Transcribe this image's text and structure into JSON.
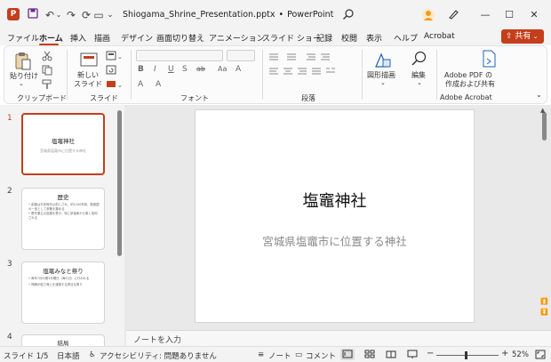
{
  "window": {
    "title": "Shiogama_Shrine_Presentation.pptx",
    "title_sep": "•",
    "app_name": "PowerPoint",
    "app_icon_letter": "P",
    "undo_label": "↶",
    "redo_label": "↷",
    "refresh_label": "⟳",
    "slideshow_label": "▭",
    "customize_label": "⌄",
    "minimize_label": "—",
    "maximize_label": "☐",
    "close_label": "✕"
  },
  "menu": {
    "tabs": [
      "ファイル",
      "ホーム",
      "挿入",
      "描画",
      "デザイン",
      "画面切り替え",
      "アニメーション",
      "スライド ショー",
      "記録",
      "校閲",
      "表示",
      "ヘルプ",
      "Acrobat"
    ],
    "active_tab": "ホーム",
    "share_label": "共有"
  },
  "ribbon": {
    "groups": [
      "クリップボード",
      "スライド",
      "フォント",
      "段落",
      "Adobe Acrobat"
    ],
    "paste_label": "貼り付け",
    "new_slide_label_line1": "新しい",
    "new_slide_label_line2": "スライド",
    "shapes_label": "図形描画",
    "edit_label": "編集",
    "adobe_label_line1": "Adobe PDF の",
    "adobe_label_line2": "作成および共有",
    "font_bold": "B",
    "font_italic": "I",
    "font_underline": "U",
    "font_strike": "S",
    "font_strike_ab": "ab",
    "font_aa": "Aa",
    "font_a": "A"
  },
  "slides": [
    {
      "number": "1",
      "title": "塩竈神社",
      "subtitle": "宮城県塩竈市に位置する神社"
    },
    {
      "number": "2",
      "title": "歴史",
      "bullets": [
        "• 創建は平安時代以前とされ、約1200年前、陸奥国の一宮として崇敬を集める",
        "• 歴代藩主の庇護を受け、特に伊達家から篤く信仰される"
      ]
    },
    {
      "number": "3",
      "title": "塩竈みなと祭り",
      "bullets": [
        "• 毎年7月の第3月曜日（海の日）に行われる",
        "• 神輿が船で海上を渡御する勇壮な祭り"
      ]
    },
    {
      "number": "4",
      "title": "結局"
    }
  ],
  "main_slide": {
    "title": "塩竈神社",
    "subtitle": "宮城県塩竈市に位置する神社"
  },
  "notes": {
    "placeholder": "ノートを入力"
  },
  "status": {
    "slide_info": "スライド 1/5",
    "language": "日本語",
    "accessibility": "アクセシビリティ: 問題ありません",
    "notes_label": "ノート",
    "comments_label": "コメント",
    "zoom_minus": "−",
    "zoom_plus": "+",
    "zoom": "52%"
  },
  "colors": {
    "accent": "#c43e1c",
    "selected_tab_underline": "#c43e1c"
  }
}
